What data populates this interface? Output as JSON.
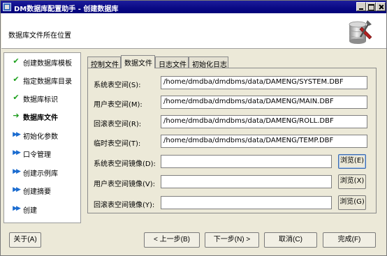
{
  "window": {
    "title": "DM数据库配置助手 - 创建数据库"
  },
  "header": {
    "title": "数据库文件所在位置"
  },
  "steps": [
    {
      "label": "创建数据库模板",
      "state": "done"
    },
    {
      "label": "指定数据库目录",
      "state": "done"
    },
    {
      "label": "数据库标识",
      "state": "done"
    },
    {
      "label": "数据库文件",
      "state": "current"
    },
    {
      "label": "初始化参数",
      "state": "pending"
    },
    {
      "label": "口令管理",
      "state": "pending"
    },
    {
      "label": "创建示例库",
      "state": "pending"
    },
    {
      "label": "创建摘要",
      "state": "pending"
    },
    {
      "label": "创建",
      "state": "pending"
    }
  ],
  "tabs": [
    {
      "label": "控制文件"
    },
    {
      "label": "数据文件",
      "active": true
    },
    {
      "label": "日志文件"
    },
    {
      "label": "初始化日志"
    }
  ],
  "fields": [
    {
      "label": "系统表空间(S):",
      "value": "/home/dmdba/dmdbms/data/DAMENG/SYSTEM.DBF"
    },
    {
      "label": "用户表空间(M):",
      "value": "/home/dmdba/dmdbms/data/DAMENG/MAIN.DBF"
    },
    {
      "label": "回滚表空间(R):",
      "value": "/home/dmdba/dmdbms/data/DAMENG/ROLL.DBF"
    },
    {
      "label": "临时表空间(T):",
      "value": "/home/dmdba/dmdbms/data/DAMENG/TEMP.DBF"
    },
    {
      "label": "系统表空间镜像(D):",
      "value": "",
      "browse": "浏览(E)"
    },
    {
      "label": "用户表空间镜像(V):",
      "value": "",
      "browse": "浏览(X)"
    },
    {
      "label": "回滚表空间镜像(Y):",
      "value": "",
      "browse": "浏览(G)"
    }
  ],
  "buttons": {
    "about": "关于(A)",
    "prev": "< 上一步(B)",
    "next": "下一步(N) >",
    "cancel": "取消(C)",
    "finish": "完成(F)"
  },
  "colors": {
    "titlebar": "#0a0a84",
    "check": "#1aa01a",
    "pending_arrow": "#1b6cd0"
  }
}
